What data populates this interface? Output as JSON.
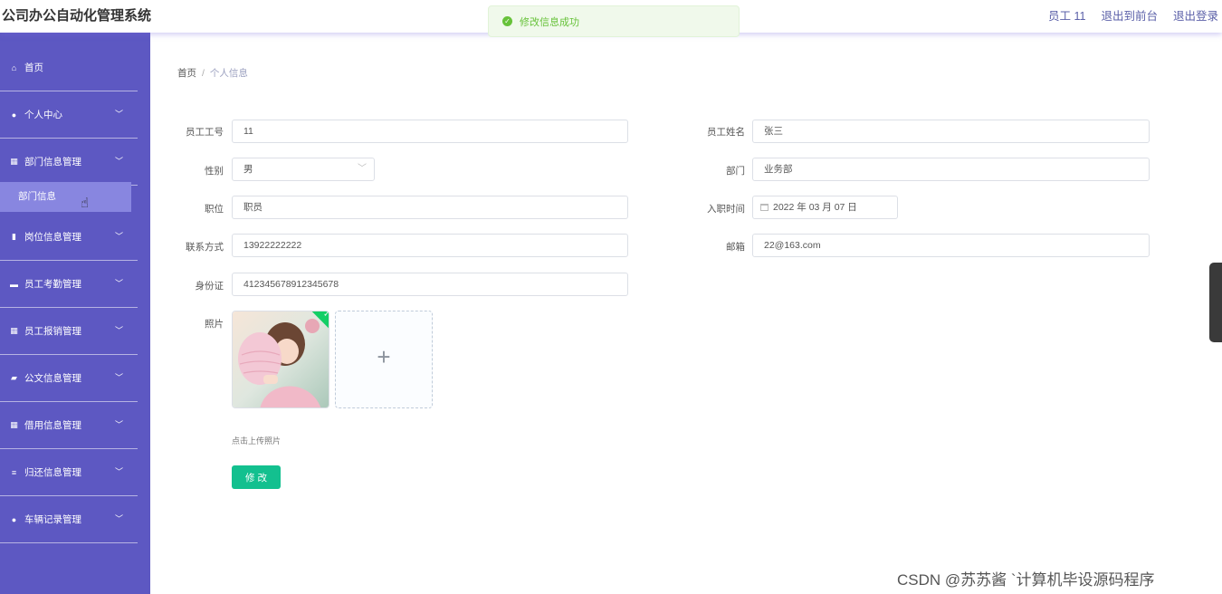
{
  "app": {
    "title": "公司办公自动化管理系统"
  },
  "header": {
    "user_label": "员工 11",
    "to_front": "退出到前台",
    "logout": "退出登录"
  },
  "toast": {
    "message": "修改信息成功",
    "icon": "success-check-icon"
  },
  "sidebar": {
    "items": [
      {
        "label": "首页",
        "icon": "home-icon"
      },
      {
        "label": "个人中心",
        "icon": "user-icon"
      },
      {
        "label": "部门信息管理",
        "icon": "grid-icon"
      },
      {
        "label": "岗位信息管理",
        "icon": "clipboard-icon"
      },
      {
        "label": "员工考勤管理",
        "icon": "monitor-icon"
      },
      {
        "label": "员工报销管理",
        "icon": "grid-icon"
      },
      {
        "label": "公文信息管理",
        "icon": "chat-icon"
      },
      {
        "label": "借用信息管理",
        "icon": "grid-icon"
      },
      {
        "label": "归还信息管理",
        "icon": "list-icon"
      },
      {
        "label": "车辆记录管理",
        "icon": "user-icon"
      }
    ],
    "sub_item": {
      "label": "部门信息"
    }
  },
  "breadcrumb": {
    "home": "首页",
    "separator": "/",
    "current": "个人信息"
  },
  "form": {
    "employee_no": {
      "label": "员工工号",
      "value": "11"
    },
    "employee_name": {
      "label": "员工姓名",
      "value": "张三"
    },
    "gender": {
      "label": "性别",
      "value": "男"
    },
    "department": {
      "label": "部门",
      "value": "业务部"
    },
    "position": {
      "label": "职位",
      "value": "职员"
    },
    "hire_date": {
      "label": "入职时间",
      "value": "2022 年 03 月 07 日"
    },
    "phone": {
      "label": "联系方式",
      "value": "13922222222"
    },
    "email": {
      "label": "邮箱",
      "value": "22@163.com"
    },
    "id_card": {
      "label": "身份证",
      "value": "412345678912345678"
    },
    "photo": {
      "label": "照片",
      "hint": "点击上传照片"
    },
    "submit_label": "修 改"
  },
  "watermark": "CSDN @苏苏酱 `计算机毕设源码程序",
  "colors": {
    "sidebar": "#5d58c2",
    "active_sub": "#8886e0",
    "submit": "#13c08f",
    "success": "#67c23a"
  }
}
